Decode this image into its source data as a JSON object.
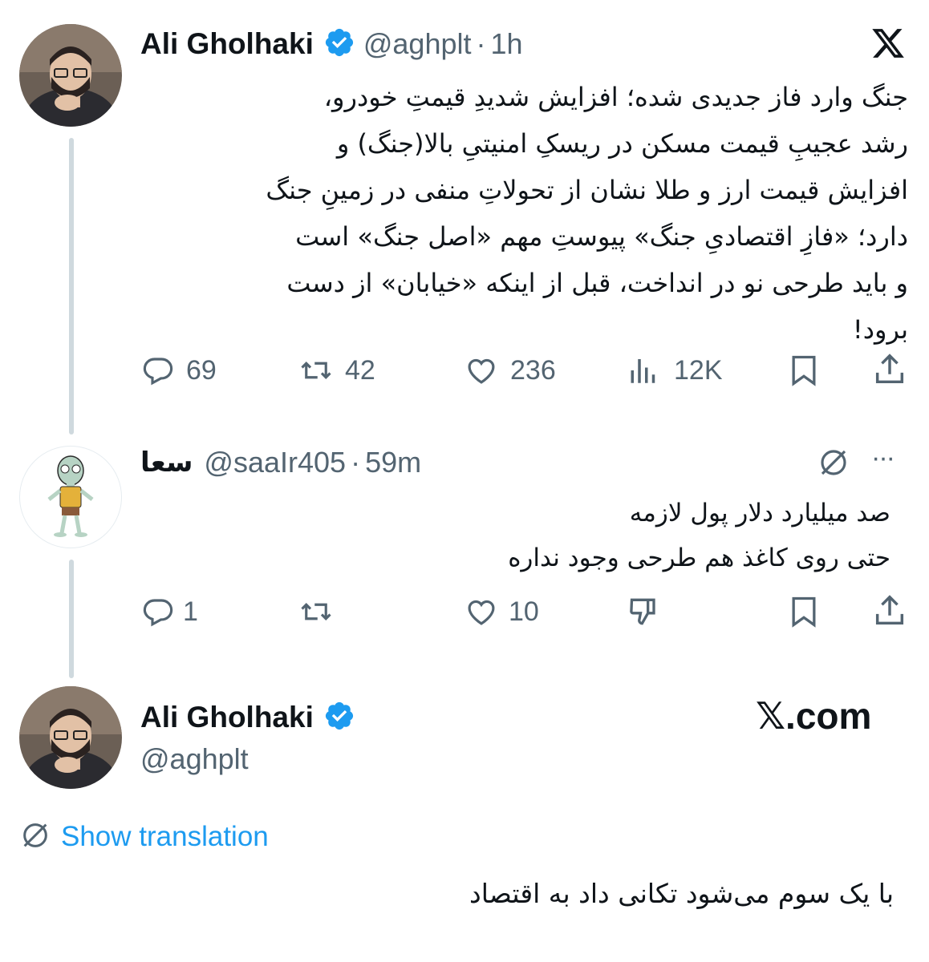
{
  "tweet1": {
    "author_name": "Ali Gholhaki",
    "handle": "@aghplt",
    "separator": "·",
    "time": "1h",
    "text_lines": [
      "جنگ وارد فاز جدیدی شده؛ افزایش شدیدِ قیمتِ خودرو،",
      "رشد عجیبِ قیمت مسکن در ریسکِ امنیتیِ بالا(جنگ) و",
      "افزایش قیمت ارز و طلا نشان از تحولاتِ منفی در زمینِ جنگ",
      "دارد؛ «فازِ اقتصادیِ جنگ» پیوستِ مهم «اصل جنگ» است",
      "و باید طرحی نو در انداخت، قبل از اینکه «خیابان» از دست",
      "برود!"
    ],
    "replies": "69",
    "reposts": "42",
    "likes": "236",
    "views": "12K"
  },
  "reply": {
    "author_name": "سعا",
    "handle": "@saaIr405",
    "separator": "·",
    "time": "59m",
    "more": "···",
    "text_lines": [
      "صد میلیارد دلار پول لازمه",
      "حتی روی کاغذ هم طرحی وجود نداره"
    ],
    "replies": "1",
    "likes": "10"
  },
  "tweet3": {
    "author_name": "Ali Gholhaki",
    "handle": "@aghplt",
    "show_translation": "Show translation",
    "text": "با یک سوم می‌شود تکانی داد به اقتصاد"
  },
  "watermark": "𝕏.com",
  "icons": [
    "x-logo-icon",
    "verified-badge-icon",
    "reply-icon",
    "repost-icon",
    "like-icon",
    "views-icon",
    "bookmark-icon",
    "share-icon",
    "grok-icon",
    "more-icon",
    "dislike-icon",
    "translate-icon"
  ],
  "colors": {
    "verified": "#1d9bf0",
    "link": "#1d9bf0",
    "muted": "#536471",
    "thread": "#cfd9de"
  }
}
